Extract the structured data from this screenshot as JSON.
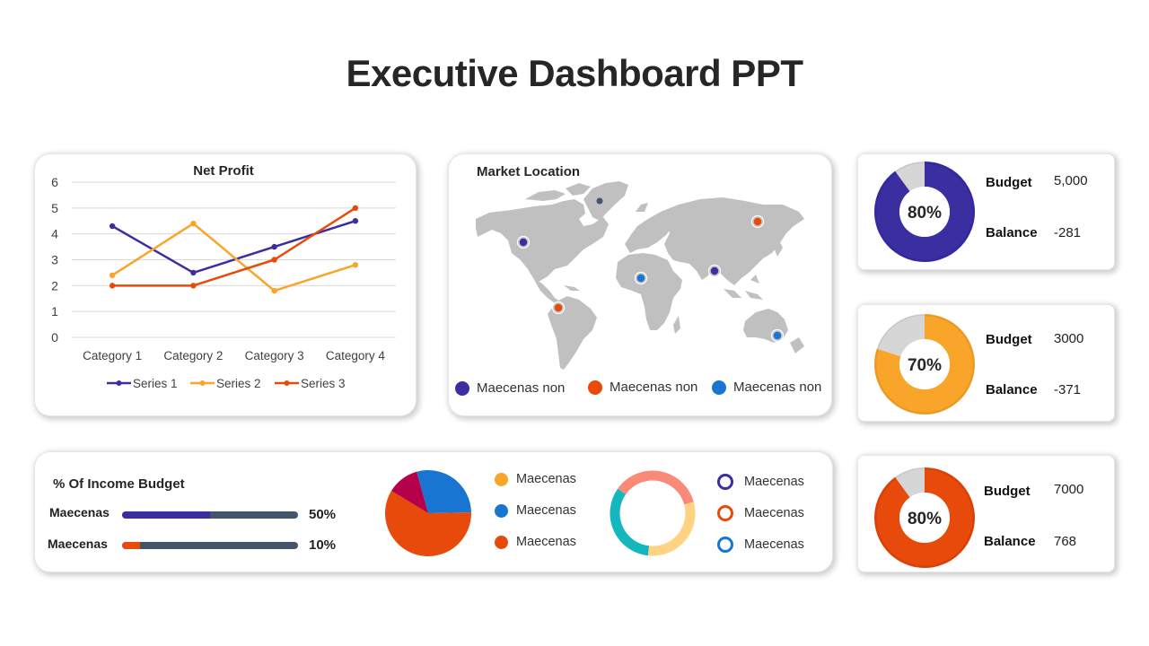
{
  "page": {
    "title": "Executive Dashboard PPT"
  },
  "net_profit": {
    "chart_data": {
      "type": "line",
      "title": "Net Profit",
      "categories": [
        "Category 1",
        "Category 2",
        "Category 3",
        "Category 4"
      ],
      "series": [
        {
          "name": "Series 1",
          "color": "#3a2ea0",
          "values": [
            4.3,
            2.5,
            3.5,
            4.5
          ]
        },
        {
          "name": "Series 2",
          "color": "#f9a52a",
          "values": [
            2.4,
            4.4,
            1.8,
            2.8
          ]
        },
        {
          "name": "Series 3",
          "color": "#e84a0c",
          "values": [
            2,
            2,
            3,
            5
          ]
        }
      ],
      "yticks": [
        "0",
        "1",
        "2",
        "3",
        "4",
        "5",
        "6"
      ],
      "ylim": [
        0,
        6
      ],
      "xlabel": "",
      "ylabel": "",
      "grid": true,
      "legend": "bottom"
    }
  },
  "market": {
    "title": "Market Location",
    "pins": [
      {
        "region": "Greenland",
        "color": "#44546a"
      },
      {
        "region": "North America",
        "color": "#3a2ea0"
      },
      {
        "region": "South America",
        "color": "#e84a0c"
      },
      {
        "region": "North Africa",
        "color": "#1875d1"
      },
      {
        "region": "South Asia",
        "color": "#3a2ea0"
      },
      {
        "region": "Siberia",
        "color": "#e84a0c"
      },
      {
        "region": "Australia",
        "color": "#1875d1"
      }
    ],
    "legend": [
      {
        "label": "Maecenas non",
        "color": "#3a2ea0"
      },
      {
        "label": "Maecenas non",
        "color": "#e84a0c"
      },
      {
        "label": "Maecenas non",
        "color": "#1875d1"
      }
    ]
  },
  "income": {
    "title": "% Of Income Budget",
    "bars": [
      {
        "label": "Maecenas",
        "percent": 50,
        "pct_label": "50%",
        "color": "#3a2ea0"
      },
      {
        "label": "Maecenas",
        "percent": 10,
        "pct_label": "10%",
        "color": "#e84a0c"
      }
    ],
    "pie": {
      "chart_data": {
        "type": "pie",
        "slices": [
          {
            "label": "blue",
            "value": 29,
            "color": "#1875d1"
          },
          {
            "label": "orange",
            "value": 59,
            "color": "#e84a0c"
          },
          {
            "label": "crimson",
            "value": 12,
            "color": "#b5004a"
          }
        ]
      },
      "legend": [
        {
          "label": "Maecenas",
          "color": "#f9a52a"
        },
        {
          "label": "Maecenas",
          "color": "#1875d1"
        },
        {
          "label": "Maecenas",
          "color": "#e84a0c"
        }
      ]
    },
    "ring": {
      "chart_data": {
        "type": "pie",
        "slices": [
          {
            "label": "salmon",
            "value": 36,
            "color": "#fa8a78"
          },
          {
            "label": "yellow",
            "value": 31,
            "color": "#ffd382"
          },
          {
            "label": "teal",
            "value": 33,
            "color": "#16b6bf"
          }
        ]
      },
      "legend": [
        {
          "label": "Maecenas",
          "color": "#3a2ea0"
        },
        {
          "label": "Maecenas",
          "color": "#e84a0c"
        },
        {
          "label": "Maecenas",
          "color": "#1875d1"
        }
      ]
    }
  },
  "stats": [
    {
      "percent_label": "80%",
      "fill_fraction": 0.9,
      "color": "#3a2ea0",
      "edge": "#3328a0",
      "budget_label": "Budget",
      "budget_value": "5,000",
      "balance_label": "Balance",
      "balance_value": "-281"
    },
    {
      "percent_label": "70%",
      "fill_fraction": 0.8,
      "color": "#f9a52a",
      "edge": "#e8992a",
      "budget_label": "Budget",
      "budget_value": "3000",
      "balance_label": "Balance",
      "balance_value": "-371"
    },
    {
      "percent_label": "80%",
      "fill_fraction": 0.9,
      "color": "#e84a0c",
      "edge": "#d4420a",
      "budget_label": "Budget",
      "budget_value": "7000",
      "balance_label": "Balance",
      "balance_value": "768"
    }
  ]
}
